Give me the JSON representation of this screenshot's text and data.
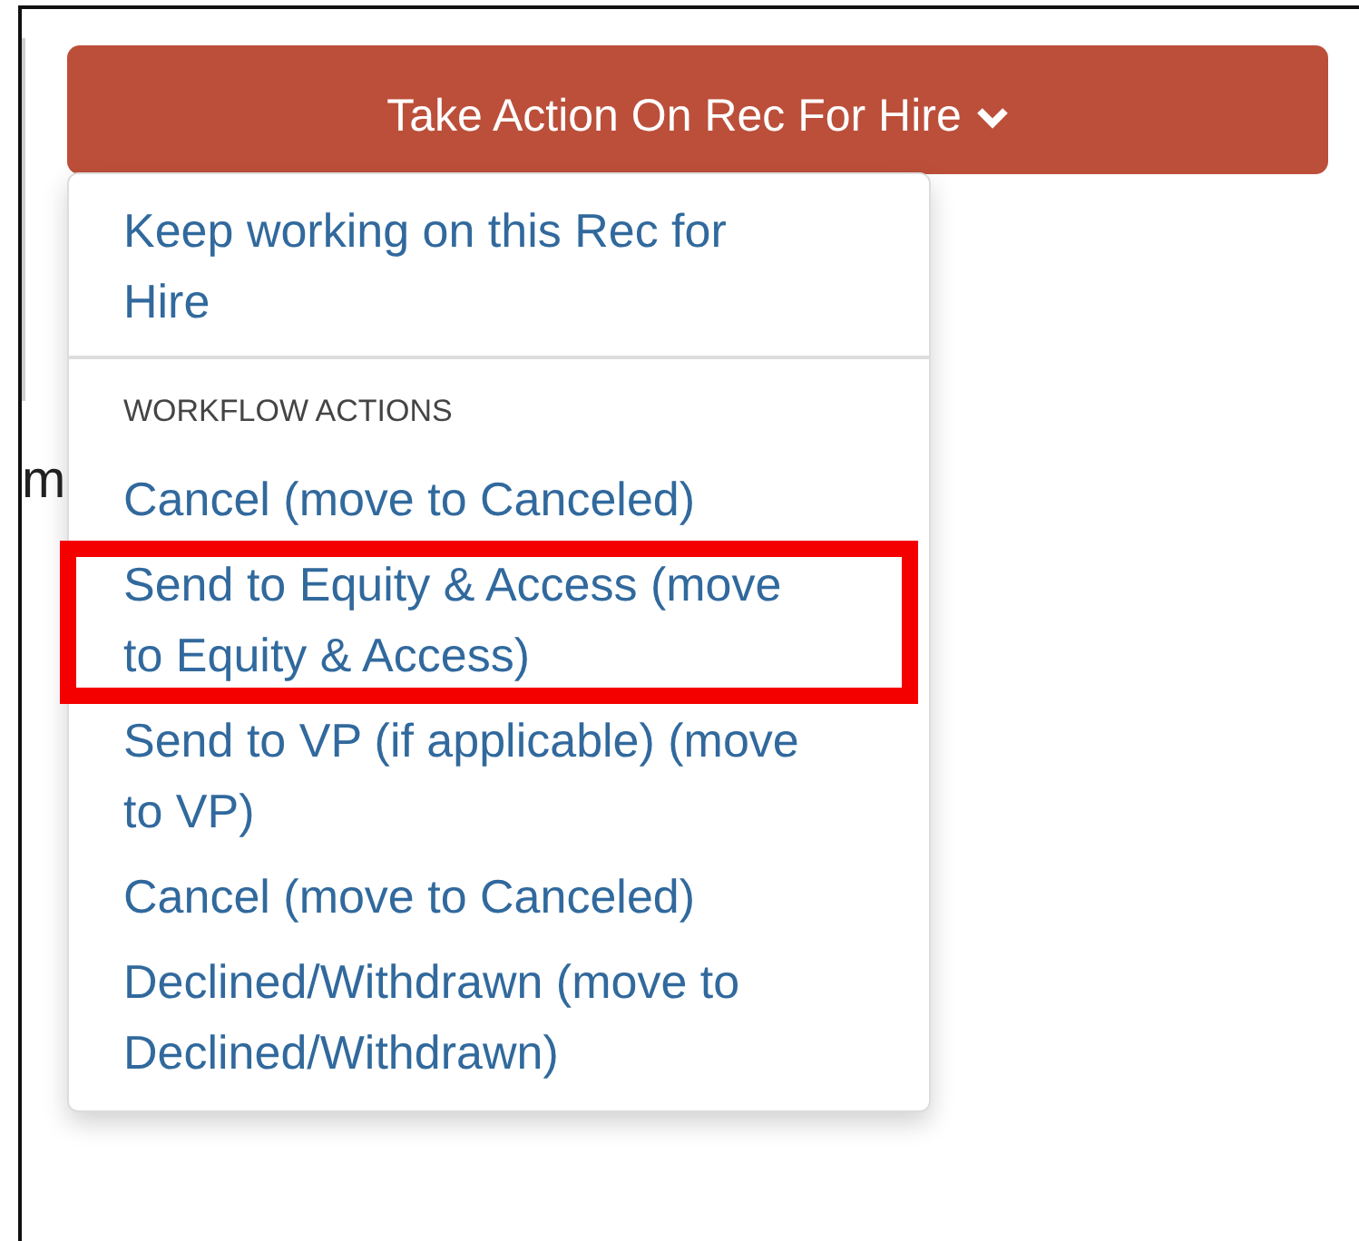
{
  "background_heading": "m",
  "action_button": {
    "label": "Take Action On Rec For Hire",
    "expanded": true
  },
  "menu": [
    {
      "kind": "item",
      "label": "Keep working on this Rec for Hire",
      "highlighted": false
    },
    {
      "kind": "divider"
    },
    {
      "kind": "header",
      "label": "WORKFLOW ACTIONS"
    },
    {
      "kind": "item",
      "label": "Cancel (move to Canceled)",
      "highlighted": false
    },
    {
      "kind": "item",
      "label": "Send to Equity & Access (move to Equity & Access)",
      "highlighted": true
    },
    {
      "kind": "item",
      "label": "Send to VP (if applicable) (move to VP)",
      "highlighted": false
    },
    {
      "kind": "item",
      "label": "Cancel (move to Canceled)",
      "highlighted": false
    },
    {
      "kind": "item",
      "label": "Declined/Withdrawn (move to Declined/Withdrawn)",
      "highlighted": false
    }
  ]
}
